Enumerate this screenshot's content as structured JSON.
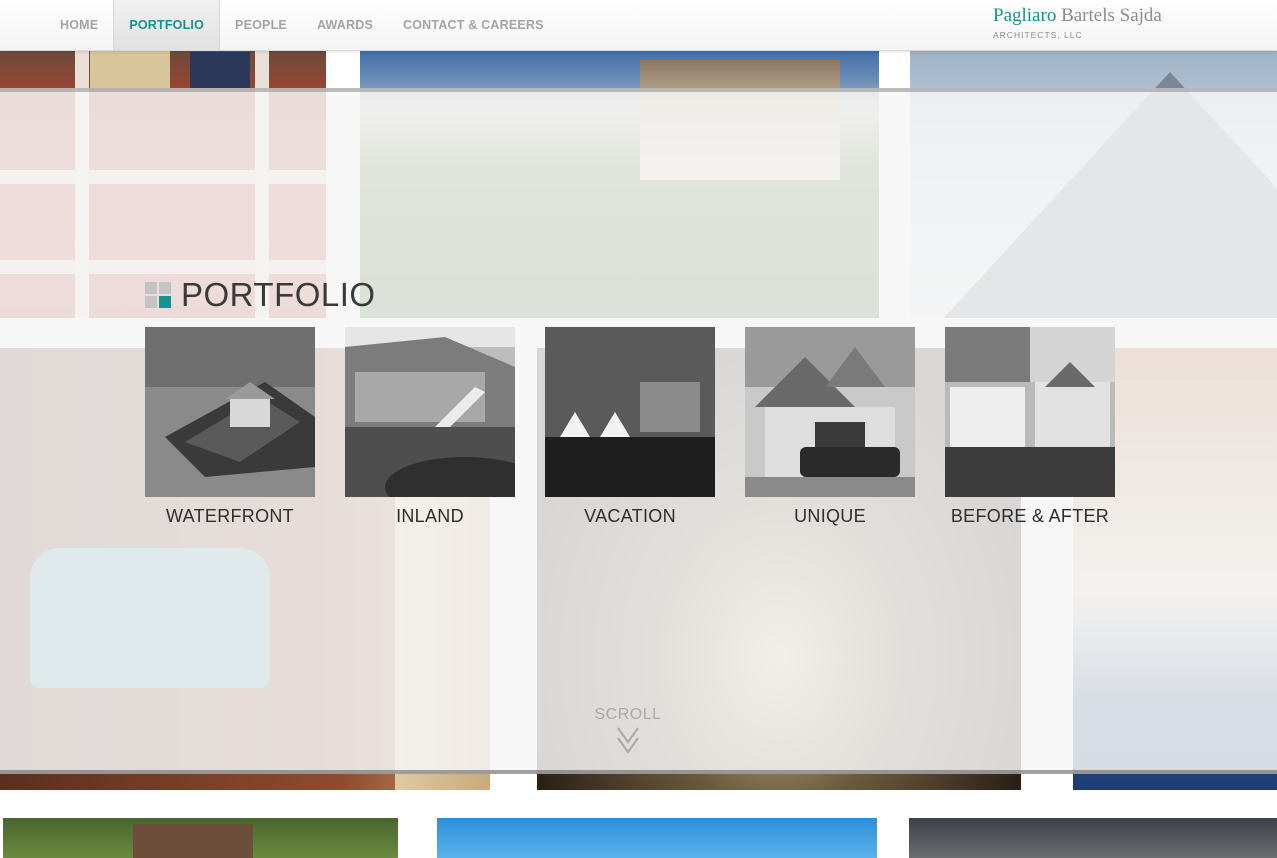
{
  "nav": {
    "items": [
      {
        "label": "HOME",
        "active": false
      },
      {
        "label": "PORTFOLIO",
        "active": true
      },
      {
        "label": "PEOPLE",
        "active": false
      },
      {
        "label": "AWARDS",
        "active": false
      },
      {
        "label": "CONTACT & CAREERS",
        "active": false
      }
    ]
  },
  "logo": {
    "name_part1": "Pagliaro",
    "name_part2": "Bartels Sajda",
    "subtitle": "ARCHITECTS, LLC"
  },
  "portfolio": {
    "title": "PORTFOLIO",
    "categories": [
      {
        "label": "WATERFRONT"
      },
      {
        "label": "INLAND"
      },
      {
        "label": "VACATION"
      },
      {
        "label": "UNIQUE"
      },
      {
        "label": "BEFORE & AFTER"
      }
    ]
  },
  "scroll": {
    "label": "SCROLL"
  },
  "colors": {
    "accent": "#14928f",
    "nav_text": "#a3a3a3",
    "heading_text": "#3a3a3a"
  }
}
